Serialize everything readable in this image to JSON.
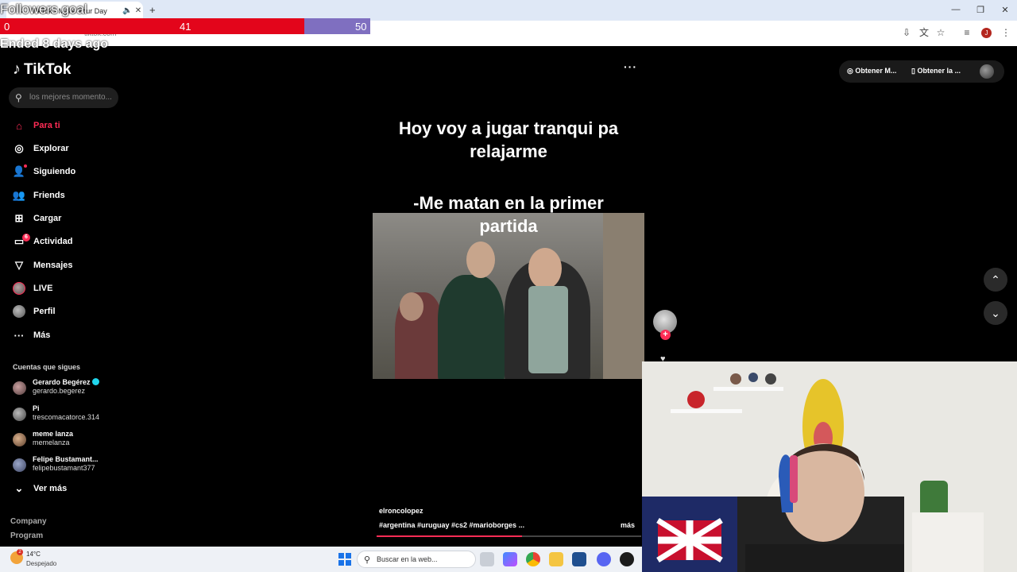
{
  "browser": {
    "tab_title": "TikTok - Make Your Day",
    "url": "tiktok.com",
    "profile_initial": "J"
  },
  "goal": {
    "label": "Followers goal",
    "current": "0",
    "mid": "41",
    "target": "50",
    "status": "Ended 8 days ago",
    "progress_fraction": 0.82,
    "colors": {
      "fill": "#e3051b",
      "remaining": "#7f6fc0"
    }
  },
  "sidebar": {
    "logo": "TikTok",
    "search_placeholder": "los mejores momento...",
    "nav": [
      {
        "label": "Para ti",
        "icon": "home-icon"
      },
      {
        "label": "Explorar",
        "icon": "compass-icon"
      },
      {
        "label": "Siguiendo",
        "icon": "following-icon"
      },
      {
        "label": "Friends",
        "icon": "friends-icon"
      },
      {
        "label": "Cargar",
        "icon": "upload-icon"
      },
      {
        "label": "Actividad",
        "icon": "activity-icon",
        "badge": "6"
      },
      {
        "label": "Mensajes",
        "icon": "messages-icon"
      },
      {
        "label": "LIVE",
        "icon": "live-icon"
      },
      {
        "label": "Perfil",
        "icon": "profile-icon"
      },
      {
        "label": "Más",
        "icon": "more-icon"
      }
    ],
    "following_title": "Cuentas que sigues",
    "following": [
      {
        "name": "Gerardo Begérez",
        "user": "gerardo.begerez",
        "verified": true
      },
      {
        "name": "Pi",
        "user": "trescomacatorce.314"
      },
      {
        "name": "meme lanza",
        "user": "memelanza"
      },
      {
        "name": "Felipe Bustamant...",
        "user": "felipebustamant377"
      }
    ],
    "see_more": "Ver más",
    "footer": [
      "Company",
      "Program"
    ]
  },
  "topbar": {
    "btn1": "Obtener M...",
    "btn2": "Obtener la ..."
  },
  "video": {
    "caption_line1": "Hoy voy a jugar tranqui pa",
    "caption_line2": "relajarme",
    "caption_line3": "-Me matan en la primer",
    "caption_line4": "partida",
    "author": "elroncolopez",
    "tags": "#argentina #uruguay #cs2 #marioborges ...",
    "more": "más",
    "progress_fraction": 0.55
  },
  "taskbar": {
    "temp": "14°C",
    "weather": "Despejado",
    "search_placeholder": "Buscar en la web..."
  },
  "colors": {
    "accent": "#fe2c55",
    "verified": "#20d5ec"
  }
}
